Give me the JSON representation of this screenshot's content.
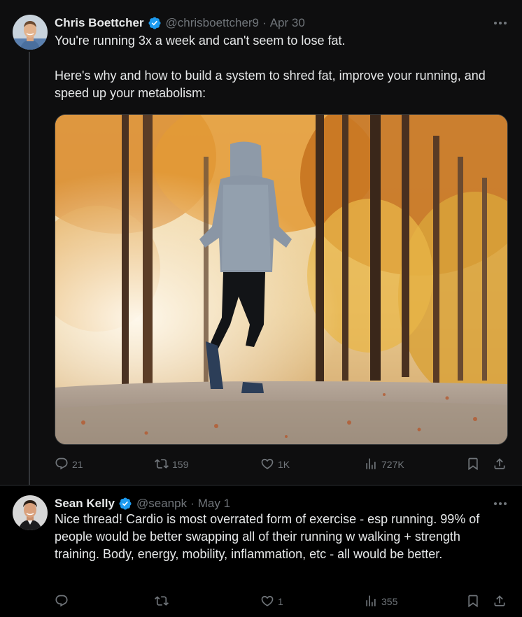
{
  "tweet1": {
    "author": {
      "name": "Chris Boettcher",
      "handle": "@chrisboettcher9",
      "date": "Apr 30"
    },
    "text": "You're running 3x a week and can't seem to lose fat.\n\nHere's why and how to build a system to shred fat, improve your running, and speed up your metabolism:",
    "stats": {
      "replies": "21",
      "retweets": "159",
      "likes": "1K",
      "views": "727K"
    }
  },
  "tweet2": {
    "author": {
      "name": "Sean Kelly",
      "handle": "@seanpk",
      "date": "May 1"
    },
    "text": "Nice thread! Cardio is most overrated form of exercise - esp running. 99% of people would be better swapping all of their running w walking + strength training. Body, energy, mobility, inflammation, etc - all would be better.",
    "stats": {
      "replies": "",
      "retweets": "",
      "likes": "1",
      "views": "355"
    }
  },
  "icons": [
    "verified-badge-icon",
    "more-icon",
    "reply-icon",
    "retweet-icon",
    "like-icon",
    "views-icon",
    "bookmark-icon",
    "share-icon"
  ],
  "colors": {
    "background": "#000000",
    "text": "#e7e9ea",
    "muted": "#71767b",
    "verified": "#1d9bf0",
    "border": "#2f3336"
  }
}
